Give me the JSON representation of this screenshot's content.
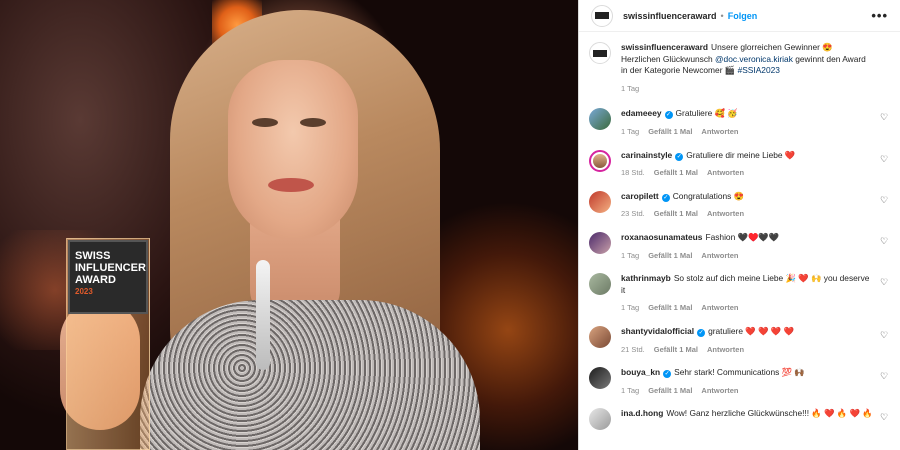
{
  "post": {
    "author": "swissinfluenceraward",
    "follow_label": "Folgen",
    "more_label": "•••",
    "image_alt": "Frau im Glitzerkleid hält den Swiss Influencer Award",
    "trophy_text": "SWISS INFLUENCER AWARD",
    "trophy_sub": "2023",
    "caption": {
      "username": "swissinfluenceraward",
      "text_1": "Unsere glorreichen Gewinner 😍 Herzlichen Glückwunsch ",
      "mention": "@doc.veronica.kiriak",
      "text_2": " gewinnt den Award in der Kategorie Newcomer 🎬 ",
      "hashtag": "#SSIA2023",
      "time": "1 Tag"
    }
  },
  "comments": [
    {
      "username": "edameeey",
      "verified": true,
      "text": "Gratuliere 🥰 🥳",
      "time": "1 Tag",
      "likes": "Gefällt 1 Mal",
      "reply": "Antworten"
    },
    {
      "username": "carinainstyle",
      "verified": true,
      "text": "Gratuliere dir meine Liebe ❤️",
      "time": "18 Std.",
      "likes": "Gefällt 1 Mal",
      "reply": "Antworten"
    },
    {
      "username": "caropilett",
      "verified": true,
      "text": "Congratulations 😍",
      "time": "23 Std.",
      "likes": "Gefällt 1 Mal",
      "reply": "Antworten"
    },
    {
      "username": "roxanaosunamateus",
      "verified": false,
      "text": "Fashion 🖤♥️🖤🖤",
      "time": "1 Tag",
      "likes": "Gefällt 1 Mal",
      "reply": "Antworten"
    },
    {
      "username": "kathrinmayb",
      "verified": false,
      "text": "So stolz auf dich meine Liebe 🎉 ❤️ 🙌 you deserve it",
      "time": "1 Tag",
      "likes": "Gefällt 1 Mal",
      "reply": "Antworten"
    },
    {
      "username": "shantyvidalofficial",
      "verified": true,
      "text": "gratuliere ❤️ ❤️ ❤️ ❤️",
      "time": "21 Std.",
      "likes": "Gefällt 1 Mal",
      "reply": "Antworten"
    },
    {
      "username": "bouya_kn",
      "verified": true,
      "text": "Sehr stark! Communications 💯 🙌🏾",
      "time": "1 Tag",
      "likes": "Gefällt 1 Mal",
      "reply": "Antworten"
    },
    {
      "username": "ina.d.hong",
      "verified": false,
      "text": "Wow! Ganz herzliche Glückwünsche!!! 🔥 ❤️ 🔥 ❤️ 🔥",
      "time": "",
      "likes": "",
      "reply": ""
    }
  ]
}
